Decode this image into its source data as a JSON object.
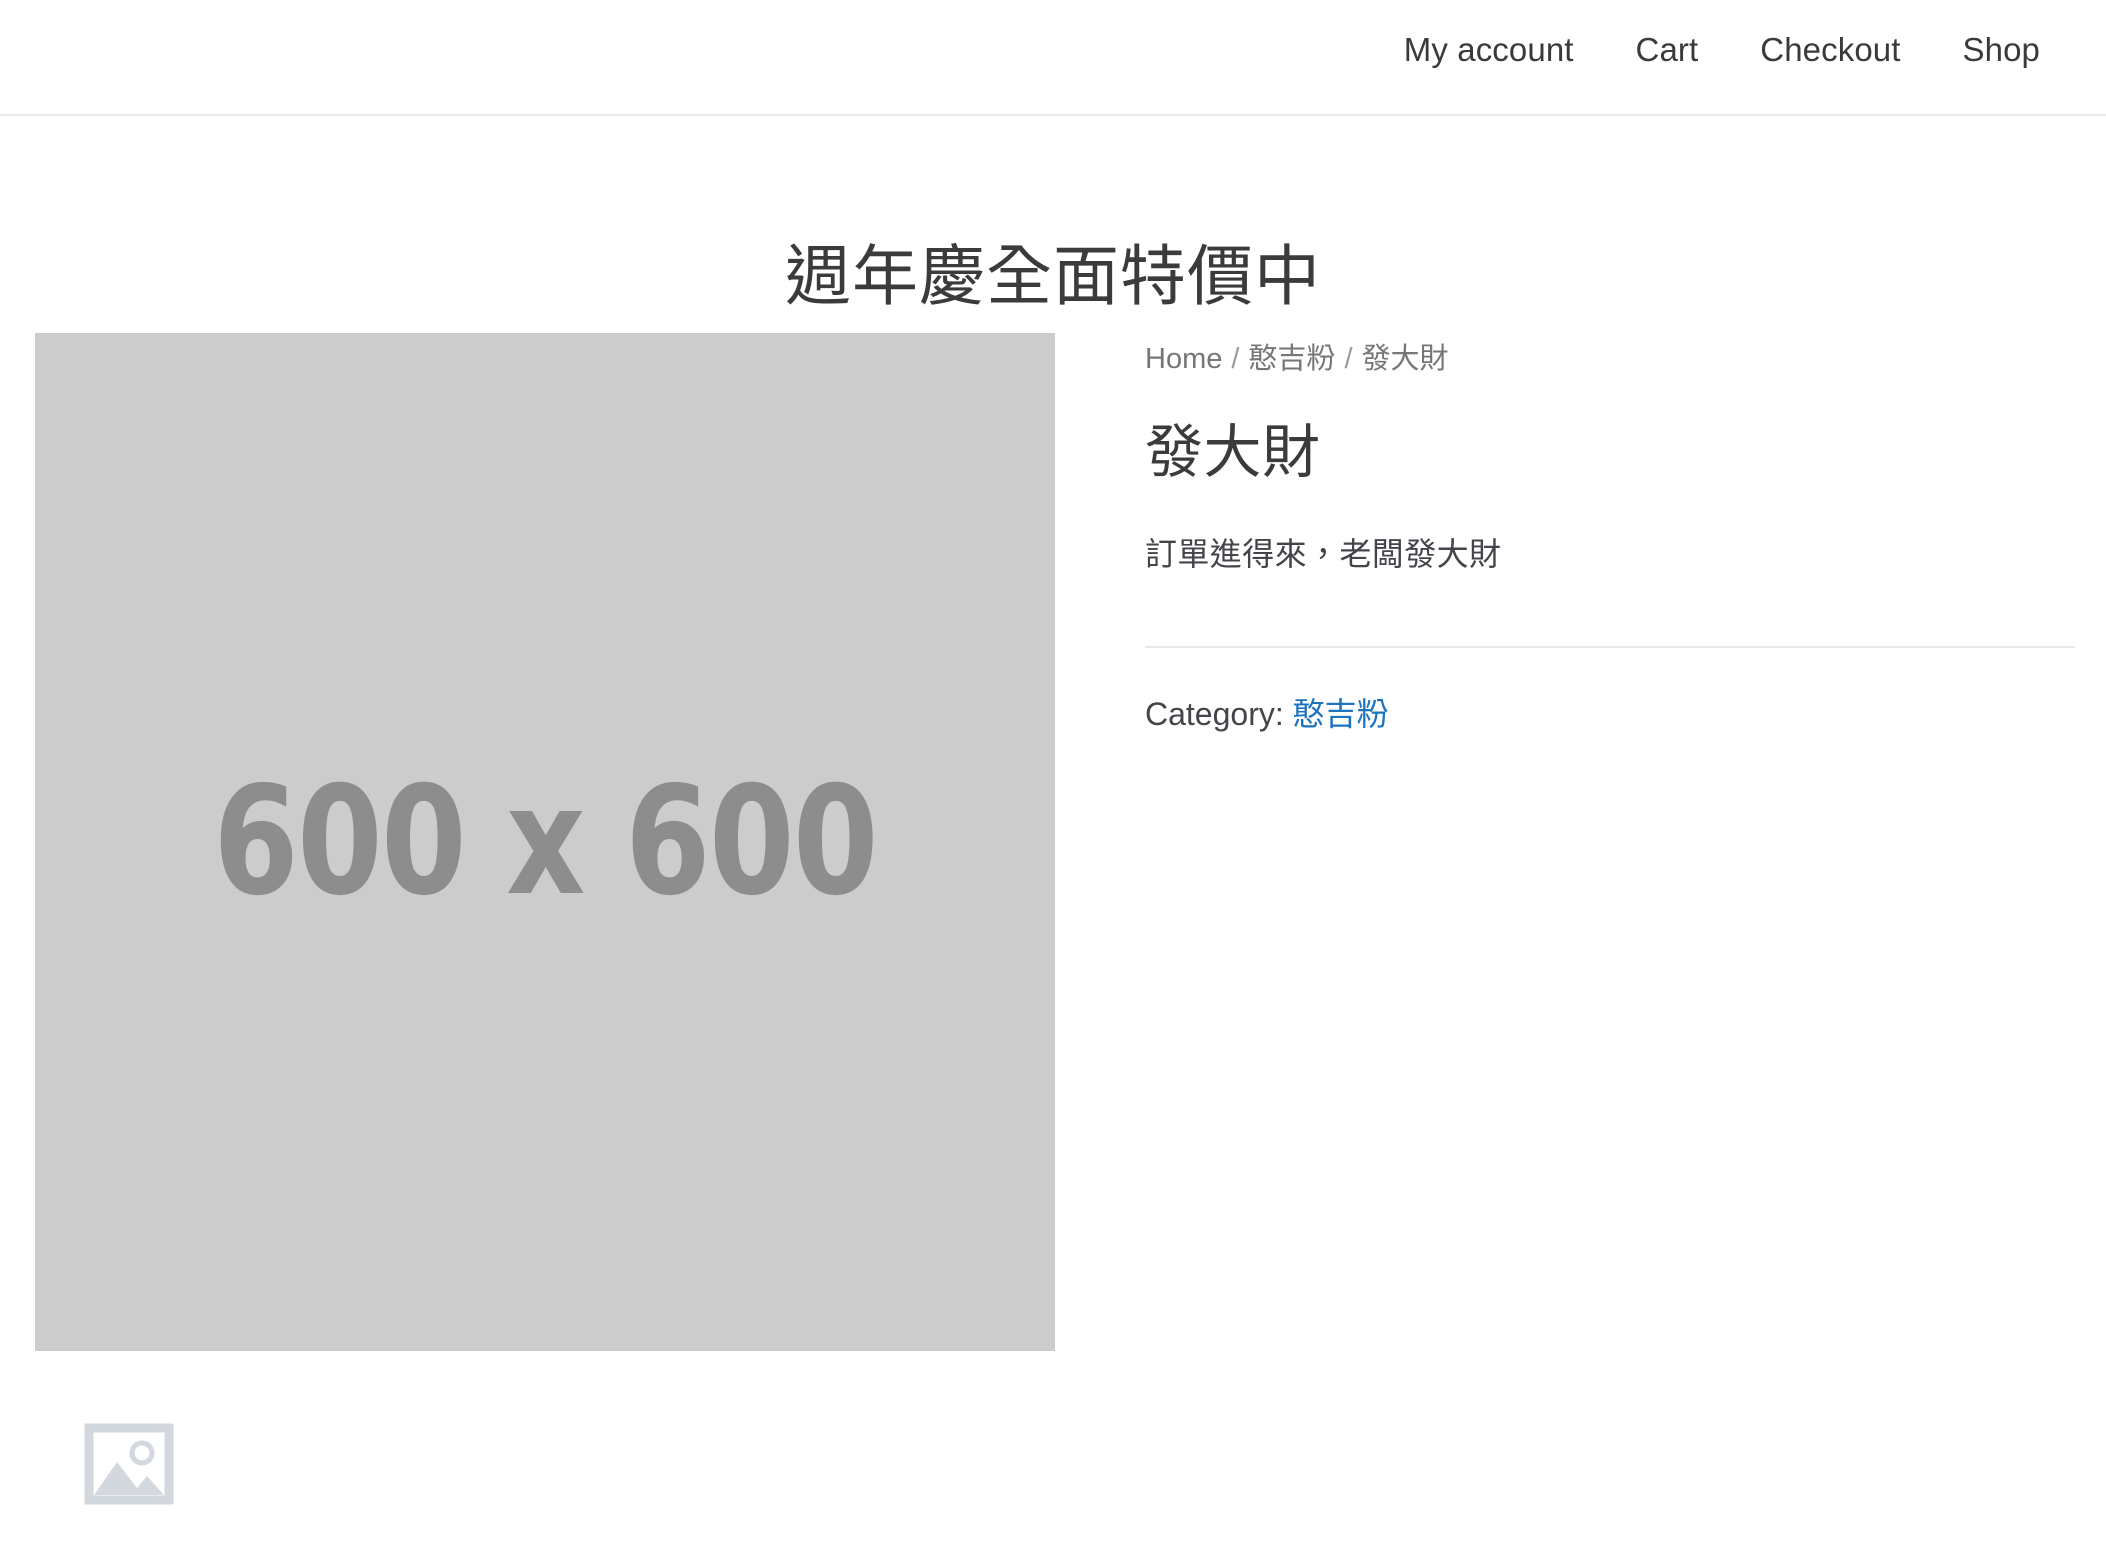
{
  "header": {
    "nav": [
      {
        "label": "My account",
        "name": "nav-item-my-account"
      },
      {
        "label": "Cart",
        "name": "nav-item-cart"
      },
      {
        "label": "Checkout",
        "name": "nav-item-checkout"
      },
      {
        "label": "Shop",
        "name": "nav-item-shop"
      }
    ]
  },
  "banner": {
    "site_title": "週年慶全面特價中"
  },
  "breadcrumb": {
    "home": "Home",
    "separator": "/",
    "category": "憨吉粉",
    "current": "發大財"
  },
  "product": {
    "title": "發大財",
    "short_description": "訂單進得來，老闆發大財",
    "gallery": {
      "main_placeholder_label": "600 x 600",
      "thumbnail_icon": "image-placeholder-icon"
    },
    "meta": {
      "category_label": "Category:",
      "category_value": "憨吉粉"
    }
  },
  "colors": {
    "link": "#1e73be",
    "text": "#43454b",
    "muted": "#767676",
    "heading": "#3b3b3b",
    "placeholder_bg": "#cccccc",
    "placeholder_fg": "#8d8d8d",
    "border": "#e8e8e8"
  }
}
